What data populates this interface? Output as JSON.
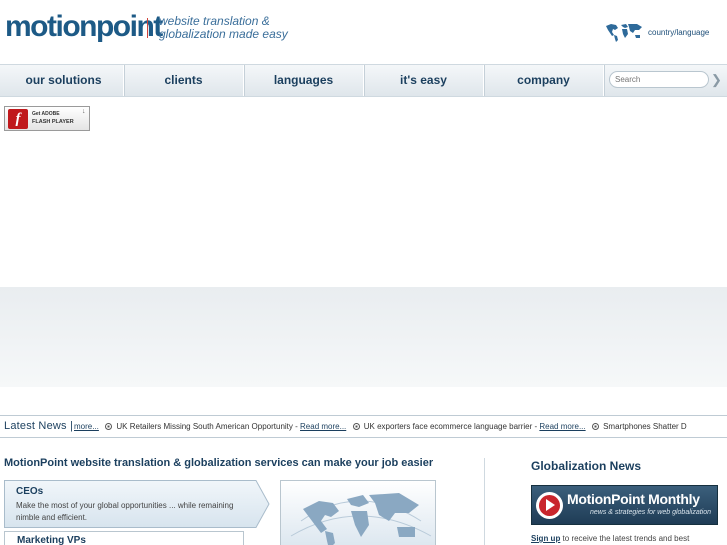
{
  "header": {
    "logo": "motionpoint",
    "tagline_line1": "website translation &",
    "tagline_line2": "globalization made easy",
    "country_label": "country/language"
  },
  "nav": {
    "items": [
      "our solutions",
      "clients",
      "languages",
      "it's easy",
      "company"
    ],
    "search_placeholder": "Search"
  },
  "flash": {
    "get_label": "Get ADOBE",
    "player_label": "FLASH PLAYER"
  },
  "ticker": {
    "label": "Latest News |",
    "more_link": "more...",
    "items": [
      {
        "text": "UK Retailers Missing South American Opportunity - ",
        "link": "Read more..."
      },
      {
        "text": "UK exporters face ecommerce language barrier - ",
        "link": "Read more..."
      },
      {
        "text": "Smartphones Shatter D",
        "link": ""
      }
    ]
  },
  "main": {
    "title": "MotionPoint website translation & globalization services can make your job easier",
    "roles": [
      {
        "title": "CEOs",
        "description": "Make the most of your global opportunities ... while remaining nimble and efficient."
      },
      {
        "title": "Marketing VPs",
        "description": ""
      }
    ]
  },
  "sidebar": {
    "title": "Globalization News",
    "monthly_name": "MotionPoint Monthly",
    "monthly_sub": "news & strategies for web globalization",
    "signup_link": "Sign up",
    "signup_text": " to receive the latest trends and best"
  },
  "colors": {
    "brand_blue": "#1d5a86",
    "nav_text": "#1b3f5e",
    "accent_red": "#c9252c"
  }
}
